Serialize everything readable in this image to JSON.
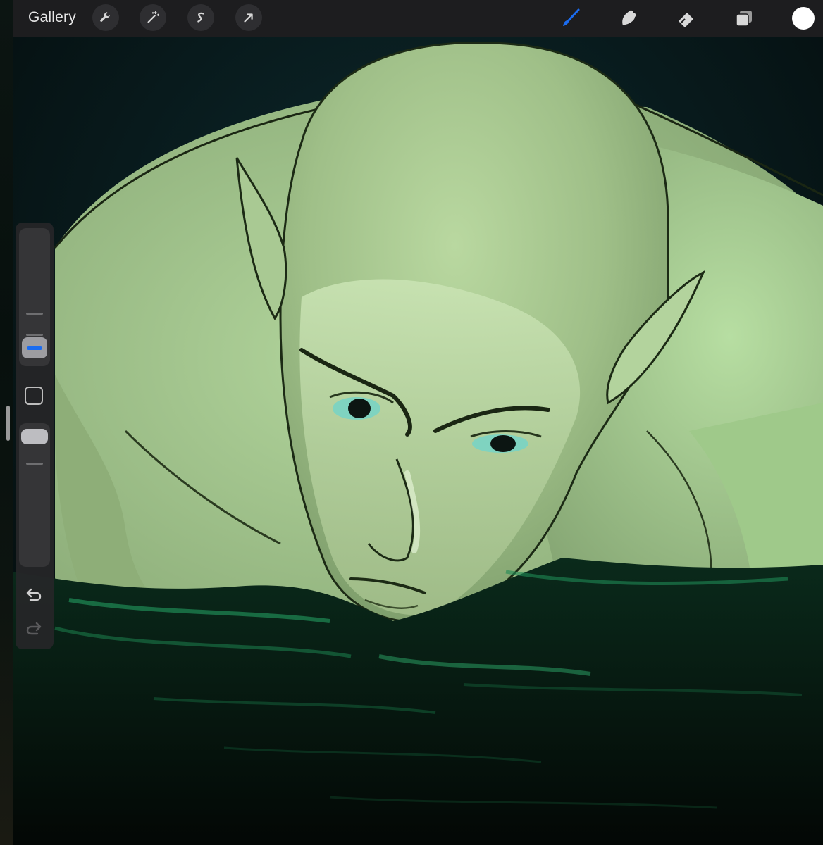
{
  "toolbar": {
    "gallery_label": "Gallery",
    "left_tools": [
      {
        "icon": "wrench-icon",
        "name": "actions"
      },
      {
        "icon": "magic-wand-icon",
        "name": "adjustments"
      },
      {
        "icon": "selection-s-icon",
        "name": "selection"
      },
      {
        "icon": "arrow-cursor-icon",
        "name": "transform"
      }
    ],
    "right_tools": [
      {
        "icon": "brush-icon",
        "name": "paint",
        "active": true
      },
      {
        "icon": "smudge-icon",
        "name": "smudge"
      },
      {
        "icon": "eraser-icon",
        "name": "eraser"
      },
      {
        "icon": "layers-icon",
        "name": "layers"
      }
    ],
    "current_color": "#ffffff"
  },
  "sidebar": {
    "brush_size_level": 0.25,
    "brush_opacity_level": 0.15,
    "icons": [
      "modify-square-icon",
      "undo-icon",
      "redo-icon"
    ]
  },
  "colors": {
    "toolbar_bg": "#1d1d1f",
    "accent_blue": "#1b6cf0",
    "skin": "#9fbf88",
    "water_glow": "#1f8a55",
    "background": "#061212"
  }
}
